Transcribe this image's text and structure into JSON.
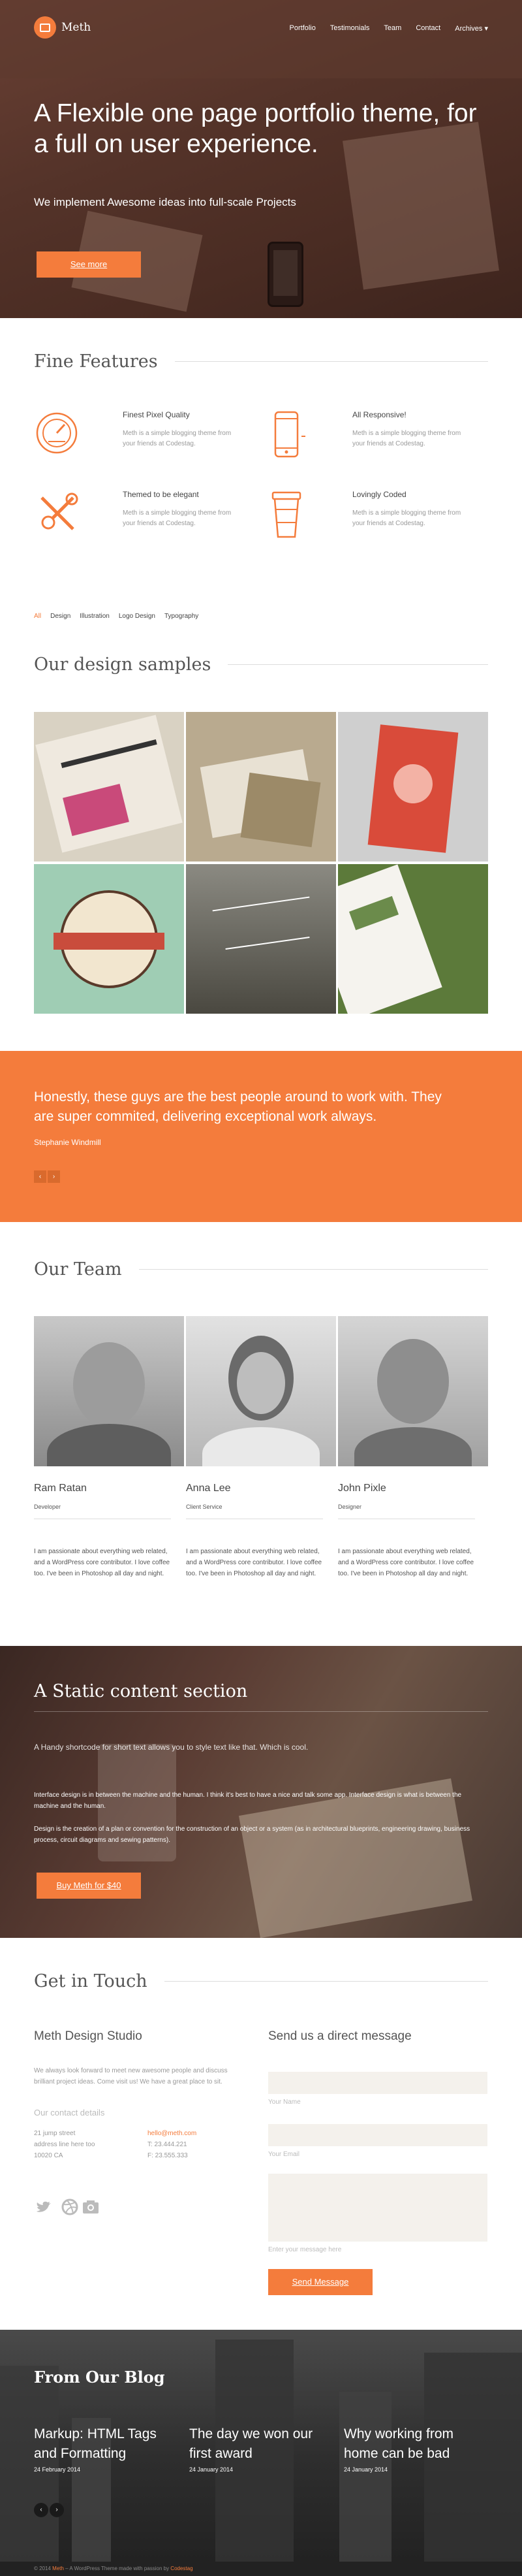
{
  "colors": {
    "accent": "#f47c3c"
  },
  "header": {
    "logo_text": "Meth",
    "nav": [
      "Portfolio",
      "Testimonials",
      "Team",
      "Contact",
      "Archives ▾"
    ]
  },
  "hero": {
    "title": "A Flexible one page portfolio theme, for a full on user experience.",
    "subtitle": "We implement Awesome ideas into full-scale Projects",
    "button": "See more"
  },
  "features": {
    "title": "Fine Features",
    "items": [
      {
        "icon": "gauge-icon",
        "title": "Finest Pixel Quality",
        "text": "Meth is a simple blogging theme from your friends at Codestag."
      },
      {
        "icon": "phone-icon",
        "title": "All Responsive!",
        "text": "Meth is a simple blogging theme from your friends at Codestag."
      },
      {
        "icon": "tools-icon",
        "title": "Themed to be elegant",
        "text": "Meth is a simple blogging theme from your friends at Codestag."
      },
      {
        "icon": "coffee-cup-icon",
        "title": "Lovingly Coded",
        "text": "Meth is a simple blogging theme from your friends at Codestag."
      }
    ]
  },
  "portfolio": {
    "filters": [
      "All",
      "Design",
      "Illustration",
      "Logo Design",
      "Typography"
    ],
    "title": "Our design samples"
  },
  "testimonial": {
    "quote": "Honestly, these guys are the best people around to work with. They are super commited, delivering exceptional work always.",
    "author": "Stephanie Windmill",
    "prev": "‹",
    "next": "›"
  },
  "team": {
    "title": "Our Team",
    "members": [
      {
        "name": "Ram Ratan",
        "role": "Developer",
        "bio": "I am passionate about everything web related, and a WordPress core contributor. I love coffee too. I've been in Photoshop all day and night."
      },
      {
        "name": "Anna Lee",
        "role": "Client Service",
        "bio": "I am passionate about everything web related, and a WordPress core contributor. I love coffee too. I've been in Photoshop all day and night."
      },
      {
        "name": "John Pixle",
        "role": "Designer",
        "bio": "I am passionate about everything web related, and a WordPress core contributor. I love coffee too. I've been in Photoshop all day and night."
      }
    ]
  },
  "static": {
    "title": "A Static content section",
    "lead": "A Handy shortcode for short text allows you to style text like that. Which is cool.",
    "p1": "Interface design is in between the machine and the human. I think it's best to have a nice and talk some app. Interface design is what is between the machine and the human.",
    "p2": "Design is the creation of a plan or convention for the construction of an object or a system (as in architectural blueprints, engineering drawing, business process, circuit diagrams and sewing patterns).",
    "button": "Buy Meth for $40"
  },
  "contact": {
    "title": "Get in Touch",
    "studio": "Meth Design Studio",
    "desc": "We always look forward to meet new awesome people and discuss brilliant project ideas. Come visit us! We have a great place to sit.",
    "details_label": "Our contact details",
    "address": [
      "21 jump street",
      "address line here too",
      "10020 CA"
    ],
    "email": "hello@meth.com",
    "phones": [
      "T: 23.444.221",
      "F: 23.555.333"
    ],
    "message_title": "Send us a direct message",
    "name_label": "Your Name",
    "email_label": "Your Email",
    "message_label": "Enter your message here",
    "send": "Send Message"
  },
  "blog": {
    "title": "From Our Blog",
    "posts": [
      {
        "title": "Markup: HTML Tags and Formatting",
        "date": "24 February 2014"
      },
      {
        "title": "The day we won our first award",
        "date": "24 January 2014"
      },
      {
        "title": "Why working from home can be bad",
        "date": "24 January 2014"
      }
    ],
    "prev": "‹",
    "next": "›"
  },
  "footer": {
    "prefix": "© 2014",
    "site": "Meth",
    "middle": " – A WordPress Theme made with passion by ",
    "author": "Codestag"
  }
}
